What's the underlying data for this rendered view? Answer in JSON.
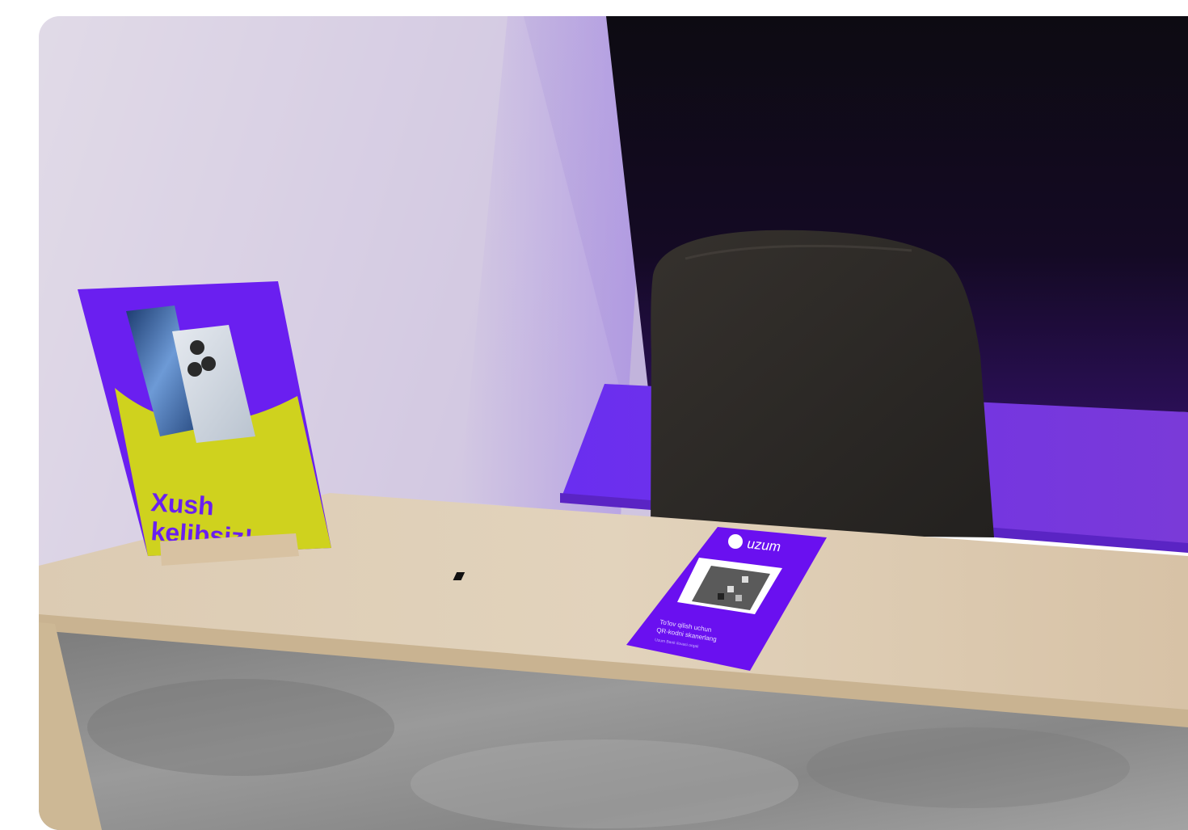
{
  "scene": {
    "stand_sign": {
      "line1": "Xush",
      "line2": "kelibsiz!"
    },
    "qr_card": {
      "brand": "uzum",
      "caption_line1": "To'lov qilish uchun",
      "caption_line2": "QR-kodni skanerlang",
      "caption_small": "Uzum Bank ilovasi orqali"
    }
  },
  "colors": {
    "brand_purple": "#6a10f0",
    "sign_yellow": "#cfd21e",
    "desk_wood": "#d9c7ad",
    "concrete": "#8f8f8f",
    "wall": "#d6cde6"
  }
}
